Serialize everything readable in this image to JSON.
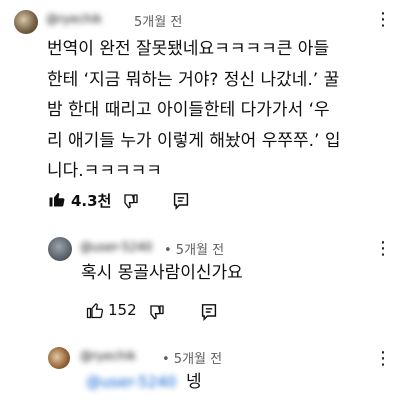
{
  "comment": {
    "handle": "@ryechik",
    "timestamp": "5개월 전",
    "body_lines": [
      "번역이 완전 잘못됐네요ㅋㅋㅋㅋ큰 아들",
      "한테 ‘지금 뭐하는 거야? 정신 나갔네.’ 꿀",
      "밤 한대 때리고 아이들한테 다가가서 ‘우",
      "리 애기들 누가 이렇게 해놨어 우쭈쭈.’ 입",
      "니다.ㅋㅋㅋㅋㅋ"
    ],
    "likes": "4.3천",
    "menu_glyph": "⋮"
  },
  "replies": [
    {
      "handle": "@user-5240",
      "timestamp": "• 5개월 전",
      "body": "혹시 몽골사람이신가요",
      "likes": "152",
      "menu_glyph": "⋮"
    },
    {
      "handle": "@ryechik",
      "timestamp": "• 5개월 전",
      "mention": "@user-5240",
      "body": "넹",
      "menu_glyph": "⋮"
    }
  ],
  "icons": [
    "thumbs-up-icon",
    "thumbs-down-icon",
    "reply-comment-icon",
    "more-vert-icon"
  ]
}
